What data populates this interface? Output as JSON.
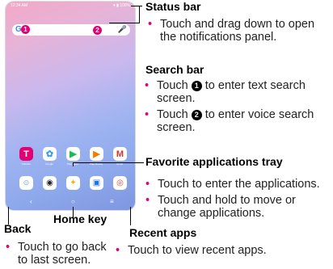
{
  "tablet": {
    "status_time": "12:34 AM",
    "status_icons": "▾ ▮ 100%",
    "search_logo": "G",
    "badge_1": "1",
    "badge_2": "2",
    "apps": [
      {
        "label": "T-Mobile",
        "glyph": "T",
        "color": "#e20074"
      },
      {
        "label": "Google",
        "glyph": "✿",
        "color": "#ffffff"
      },
      {
        "label": "Play Store",
        "glyph": "▶",
        "color": "#ffffff"
      },
      {
        "label": "Play Movies",
        "glyph": "▶",
        "color": "#ffffff"
      },
      {
        "label": "Gmail",
        "glyph": "M",
        "color": "#ffffff"
      }
    ],
    "dock": [
      {
        "glyph": "☺",
        "color": "#ffffff"
      },
      {
        "glyph": "◉",
        "color": "#ffffff"
      },
      {
        "glyph": "✦",
        "color": "#ffffff"
      },
      {
        "glyph": "▣",
        "color": "#ffffff"
      },
      {
        "glyph": "◎",
        "color": "#ffffff"
      }
    ],
    "nav_back": "‹",
    "nav_home": "○",
    "nav_recent": "≡"
  },
  "annotations": {
    "status_bar": {
      "title": "Status bar",
      "bullets": [
        "Touch and drag down to open the notifications panel."
      ]
    },
    "search_bar": {
      "title": "Search bar",
      "bullet1_pre": "Touch ",
      "bullet1_num": "1",
      "bullet1_post": " to enter text search screen.",
      "bullet2_pre": "Touch ",
      "bullet2_num": "2",
      "bullet2_post": " to enter voice search screen."
    },
    "favorites": {
      "title": "Favorite applications tray",
      "bullets": [
        "Touch to enter the applications.",
        "Touch and hold to move or change applications."
      ]
    },
    "home_key": {
      "title": "Home key"
    },
    "back": {
      "title": "Back",
      "bullet": "Touch to go back to last screen."
    },
    "recent_apps": {
      "title": "Recent apps",
      "bullet": "Touch to view recent apps."
    }
  },
  "colors": {
    "accent": "#e20074",
    "line": "#000000"
  }
}
